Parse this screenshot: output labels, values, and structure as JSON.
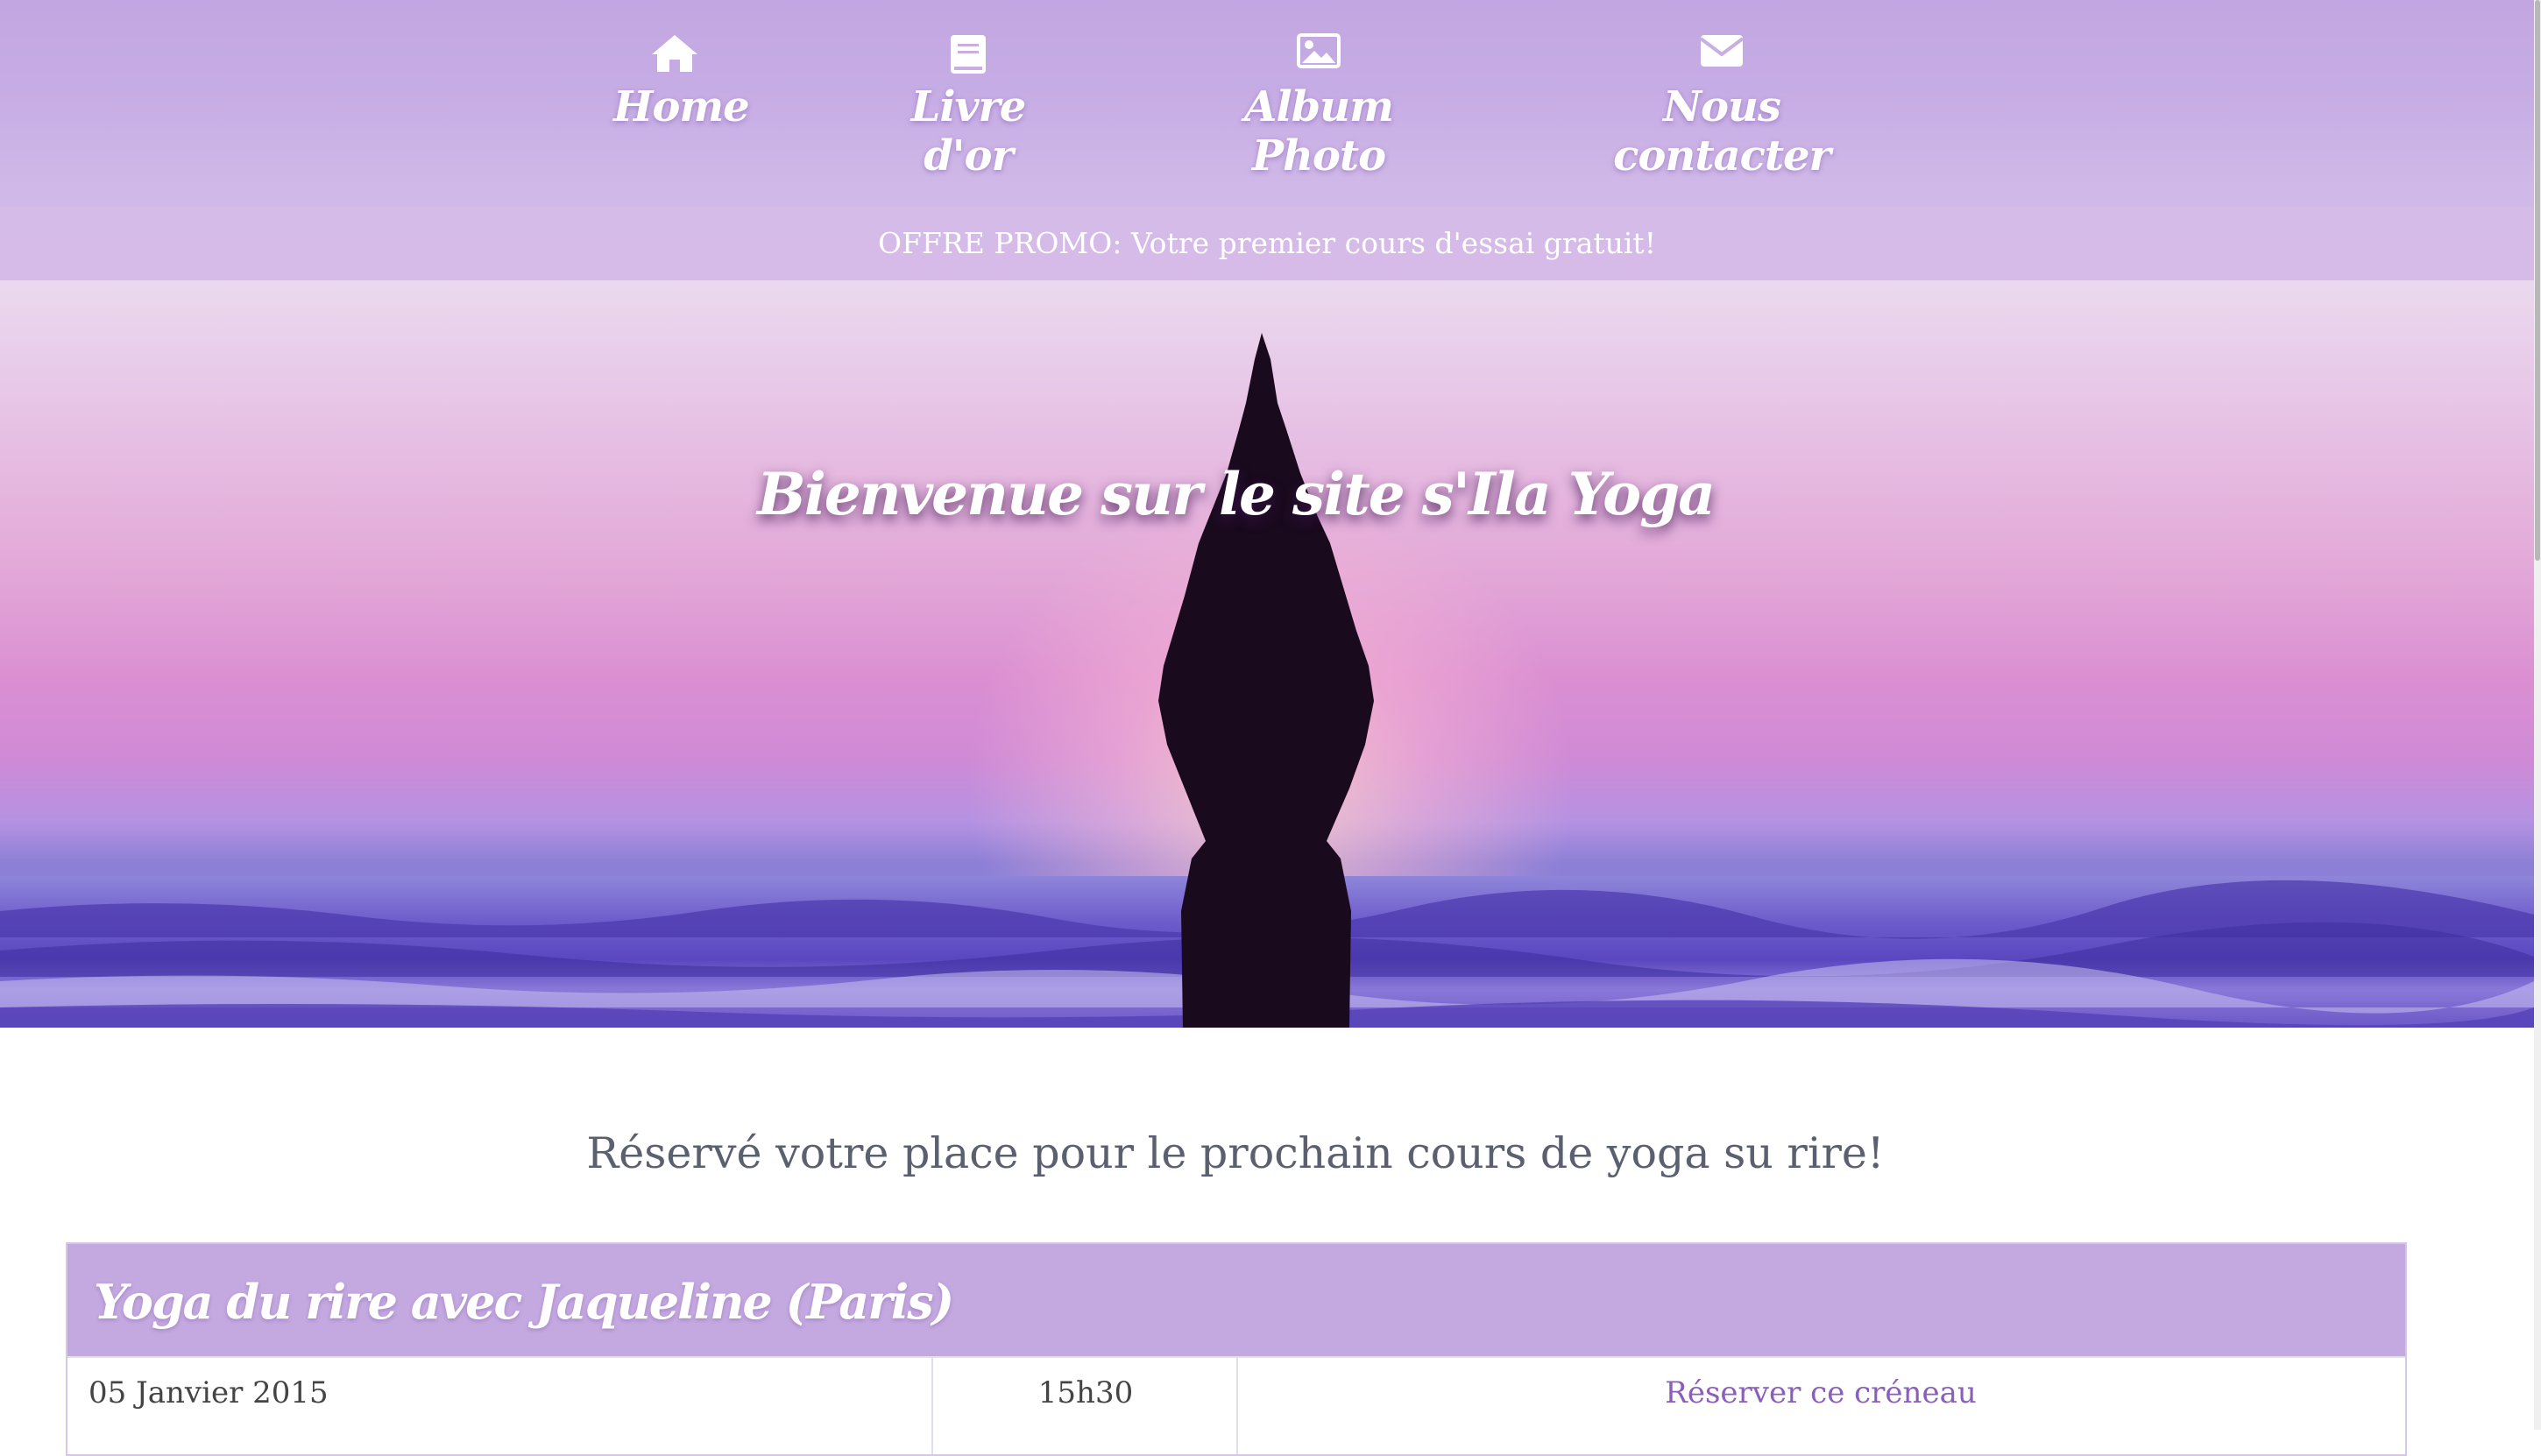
{
  "nav": {
    "items": [
      {
        "label": "Home",
        "icon": "home-icon"
      },
      {
        "label": "Livre d'or",
        "icon": "book-icon"
      },
      {
        "label": "Album Photo",
        "icon": "image-icon"
      },
      {
        "label": "Nous contacter",
        "icon": "envelope-icon"
      }
    ]
  },
  "promo": {
    "text": "OFFRE PROMO: Votre premier cours d'essai gratuit!"
  },
  "hero": {
    "title": "Bienvenue sur le site s'Ila Yoga"
  },
  "section": {
    "title": "Réservé votre place pour le prochain cours de yoga su rire!"
  },
  "schedule": {
    "header": "Yoga du rire avec Jaqueline (Paris)",
    "rows": [
      {
        "date": "05 Janvier 2015",
        "time": "15h30",
        "action": "Réserver ce créneau"
      }
    ]
  },
  "colors": {
    "accent": "#c4a8e0",
    "link": "#8a5fb8",
    "heading": "#5a6070"
  }
}
